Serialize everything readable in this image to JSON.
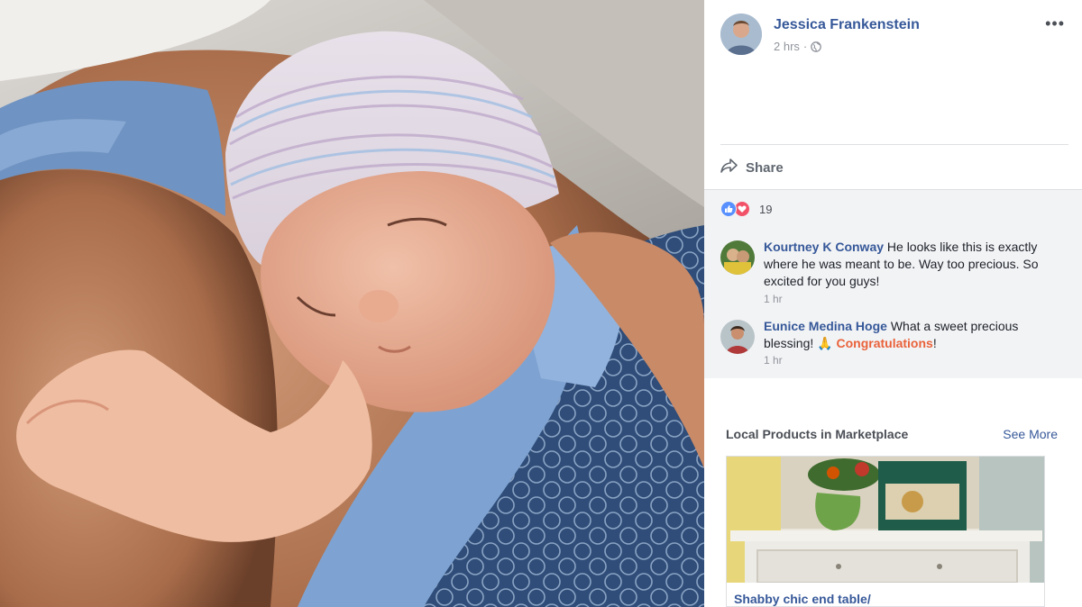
{
  "post": {
    "author_name": "Jessica Frankenstein",
    "time": "2 hrs",
    "time_separator": "·",
    "privacy_icon": "globe-icon",
    "more_icon": "ellipsis-icon",
    "more_label": "•••"
  },
  "actions": {
    "share_label": "Share",
    "share_icon": "share-arrow-icon"
  },
  "reactions": {
    "icons": [
      "like-icon",
      "love-icon"
    ],
    "count": "19"
  },
  "comments": [
    {
      "author": "Kourtney K Conway",
      "text": "He looks like this is exactly where he was meant to be. Way too precious. So excited for you guys!",
      "time": "1 hr"
    },
    {
      "author": "Eunice Medina Hoge",
      "text_before": "What a sweet precious blessing! ",
      "emoji": "🙏",
      "link_text": "Congratulations",
      "text_after": "!",
      "time": "1 hr"
    }
  ],
  "marketplace": {
    "title": "Local Products in Marketplace",
    "see_more": "See More",
    "item_title": "Shabby chic end table/"
  },
  "colors": {
    "link_blue": "#365899",
    "like_blue": "#5890ff",
    "love_red": "#f25268",
    "congrats_orange": "#e9623b",
    "comment_bg": "#f2f3f5"
  }
}
